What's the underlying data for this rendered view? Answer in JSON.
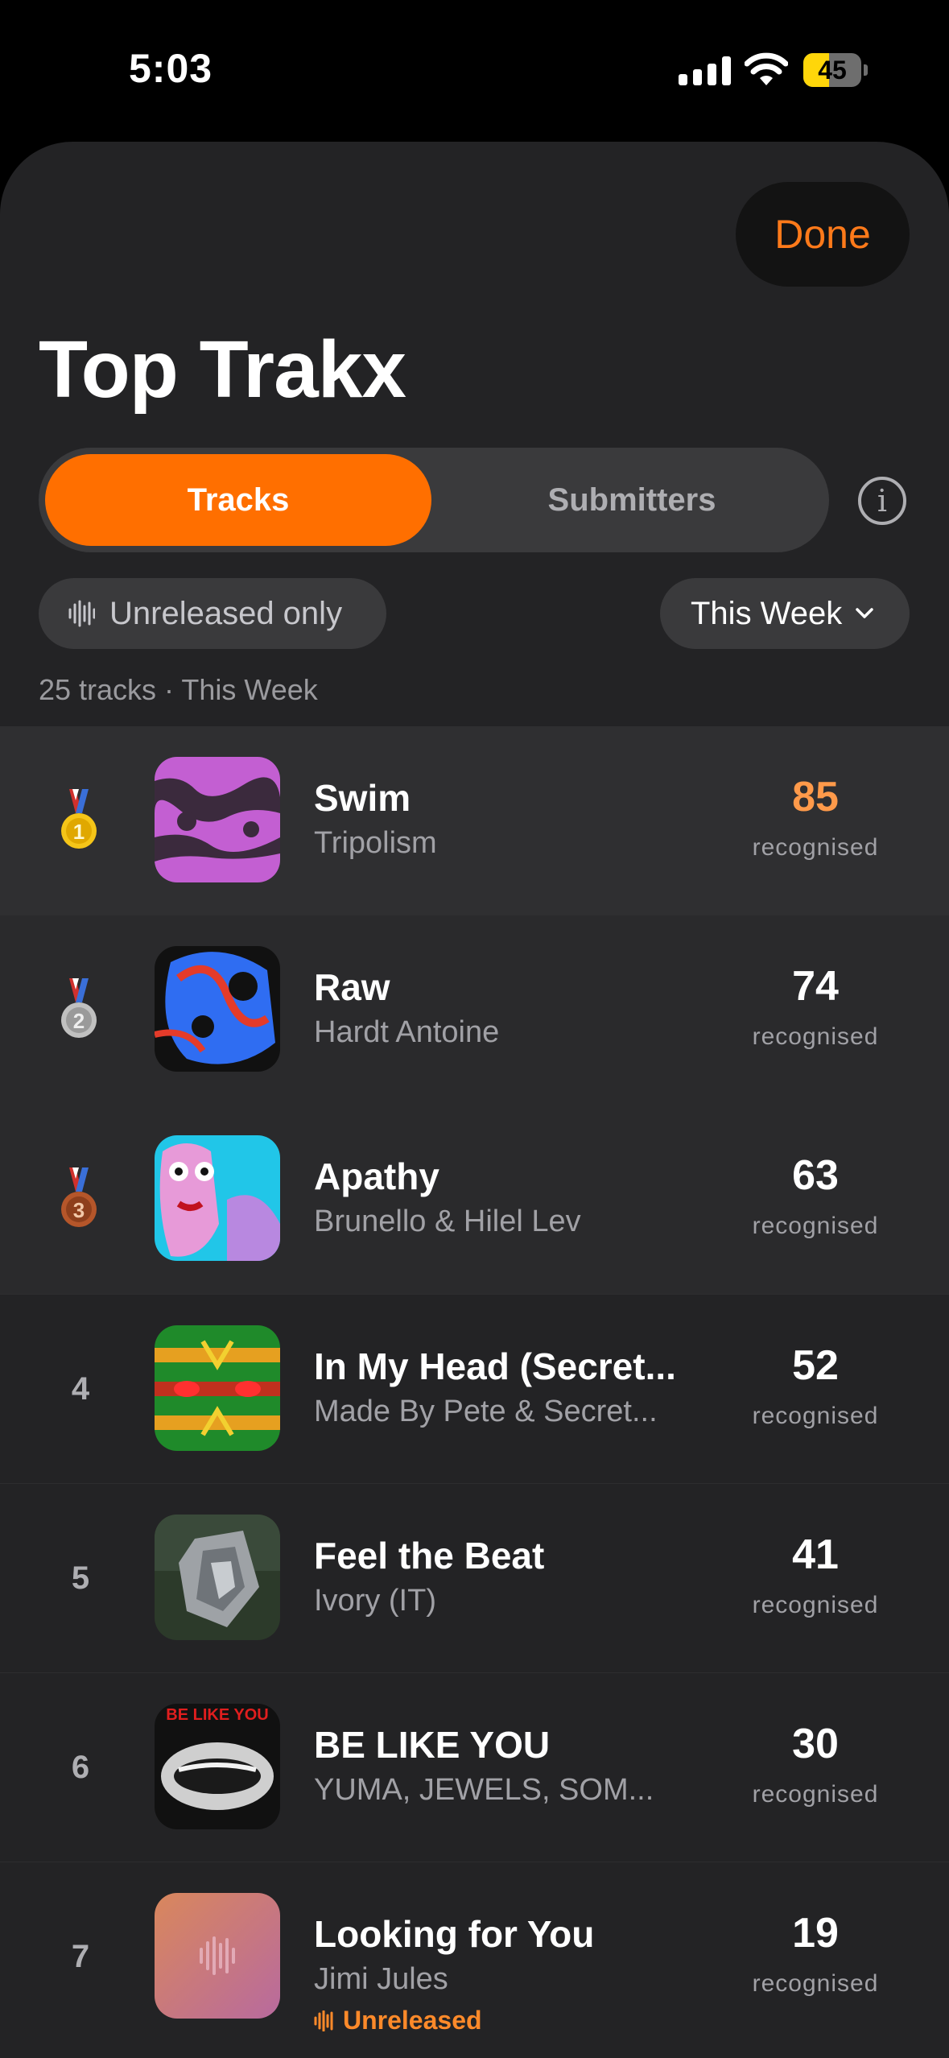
{
  "status": {
    "time": "5:03",
    "battery": "45"
  },
  "header": {
    "done_label": "Done",
    "title": "Top Trakx"
  },
  "segments": {
    "tracks": "Tracks",
    "submitters": "Submitters"
  },
  "filters": {
    "unreleased_label": "Unreleased only",
    "period_label": "This Week"
  },
  "summary": "25 tracks · This Week",
  "count_label": "recognised",
  "colors": {
    "accent": "#ff6f00",
    "done": "#ff7a1a",
    "gold": "#f5c518",
    "silver": "#b0b0b0",
    "bronze": "#a0522d"
  },
  "tracks": [
    {
      "rank": "1",
      "medal": "gold-medal-icon",
      "title": "Swim",
      "artist": "Tripolism",
      "count": "85"
    },
    {
      "rank": "2",
      "medal": "silver-medal-icon",
      "title": "Raw",
      "artist": "Hardt Antoine",
      "count": "74"
    },
    {
      "rank": "3",
      "medal": "bronze-medal-icon",
      "title": "Apathy",
      "artist": "Brunello & Hilel Lev",
      "count": "63"
    },
    {
      "rank": "4",
      "title": "In My Head (Secret...",
      "artist": "Made By Pete & Secret...",
      "count": "52"
    },
    {
      "rank": "5",
      "title": "Feel the Beat",
      "artist": "Ivory (IT)",
      "count": "41"
    },
    {
      "rank": "6",
      "title": "BE LIKE YOU",
      "artist": "YUMA, JEWELS, SOM...",
      "count": "30",
      "art_text": "BE LIKE YOU"
    },
    {
      "rank": "7",
      "title": "Looking for You",
      "artist": "Jimi Jules",
      "count": "19",
      "tag": "Unreleased"
    }
  ]
}
